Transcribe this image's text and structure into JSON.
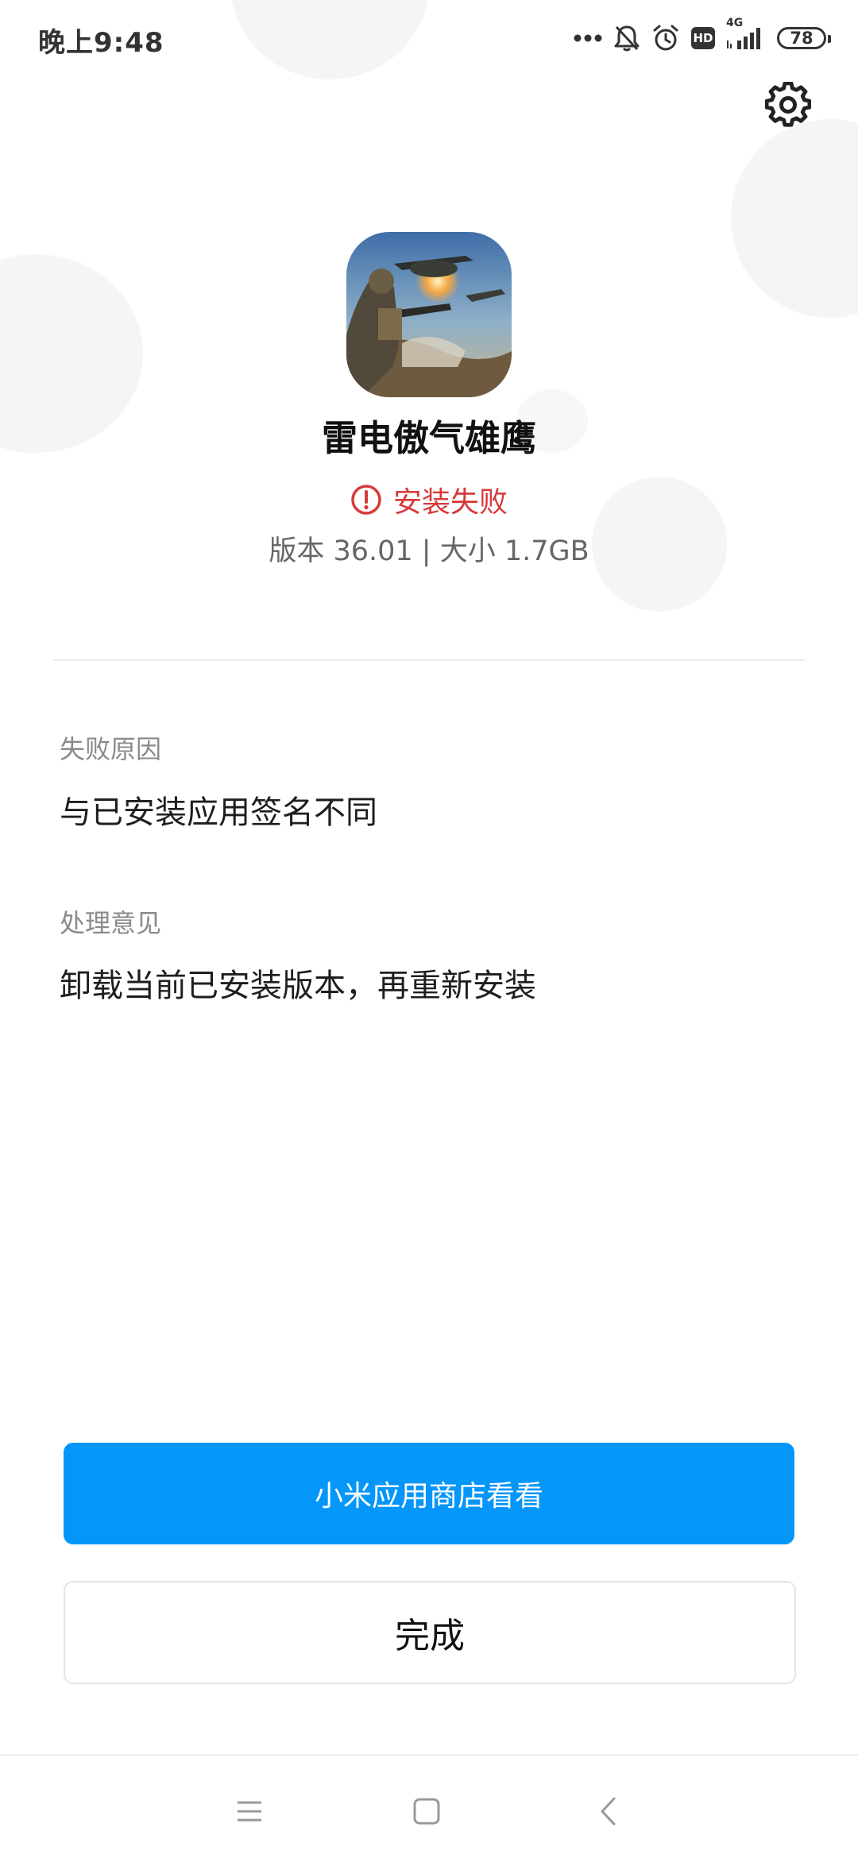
{
  "status_bar": {
    "time": "晚上9:48",
    "hd_label": "HD",
    "network_label": "4G",
    "battery_level": "78",
    "icons": [
      "more-dots-icon",
      "notifications-muted-icon",
      "alarm-icon",
      "hd-icon",
      "signal-4g-icon",
      "battery-icon"
    ]
  },
  "header": {
    "settings_icon": "gear-icon"
  },
  "app": {
    "name": "雷电傲气雄鹰",
    "install_status": "安装失败",
    "status_icon": "error-circle-icon",
    "meta": "版本 36.01 | 大小 1.7GB"
  },
  "details": {
    "reason_label": "失败原因",
    "reason_value": "与已安装应用签名不同",
    "advice_label": "处理意见",
    "advice_value": "卸载当前已安装版本，再重新安装"
  },
  "actions": {
    "store_button": "小米应用商店看看",
    "done_button": "完成"
  },
  "nav_bar": {
    "icons": [
      "menu-icon",
      "home-icon",
      "back-icon"
    ]
  },
  "colors": {
    "accent": "#0596fa",
    "error": "#d63a3a"
  }
}
